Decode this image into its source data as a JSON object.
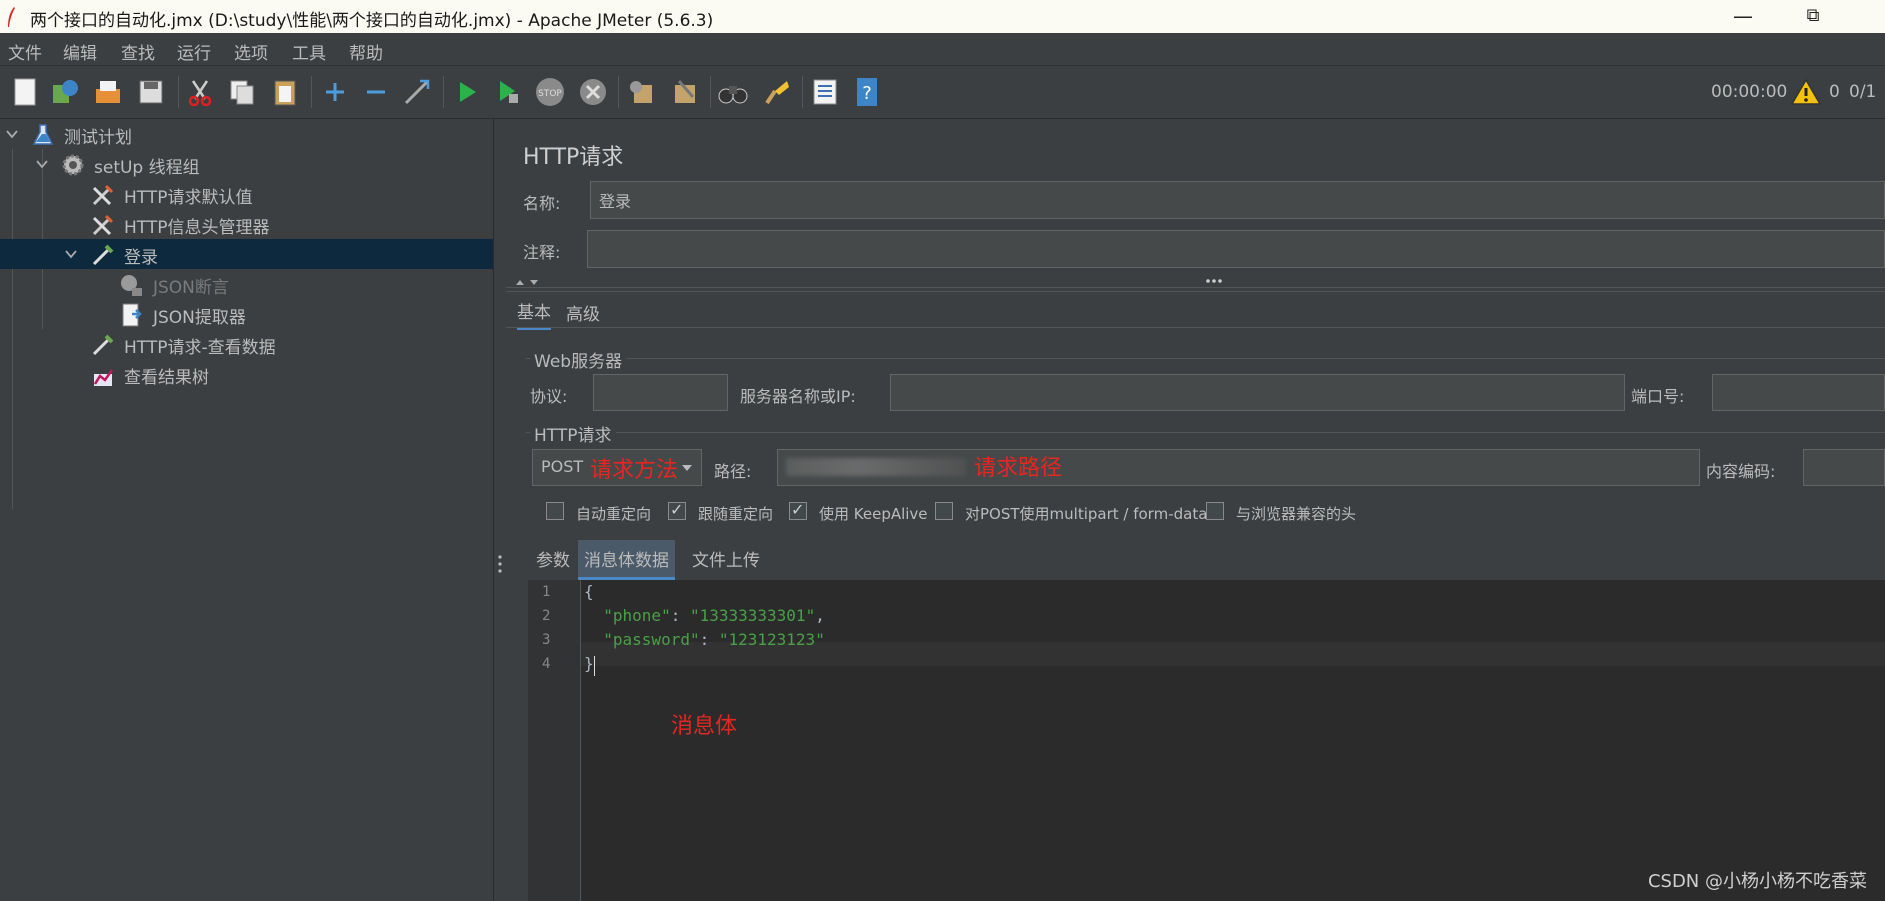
{
  "window": {
    "title": "两个接口的自动化.jmx (D:\\study\\性能\\两个接口的自动化.jmx) - Apache JMeter (5.6.3)",
    "minimize": "—",
    "restore": "⧉"
  },
  "menu": [
    "文件",
    "编辑",
    "查找",
    "运行",
    "选项",
    "工具",
    "帮助"
  ],
  "toolbar_status": {
    "timer": "00:00:00",
    "warnings": "0",
    "threads": "0/1"
  },
  "tree": [
    {
      "label": "测试计划"
    },
    {
      "label": "setUp 线程组"
    },
    {
      "label": "HTTP请求默认值"
    },
    {
      "label": "HTTP信息头管理器"
    },
    {
      "label": "登录"
    },
    {
      "label": "JSON断言"
    },
    {
      "label": "JSON提取器"
    },
    {
      "label": "HTTP请求-查看数据"
    },
    {
      "label": "查看结果树"
    }
  ],
  "panel": {
    "title": "HTTP请求",
    "name_label": "名称:",
    "name_value": "登录",
    "comment_label": "注释:",
    "comment_value": "",
    "tabs": [
      "基本",
      "高级"
    ],
    "web_server": {
      "group": "Web服务器",
      "protocol_label": "协议:",
      "server_label": "服务器名称或IP:",
      "port_label": "端口号:"
    },
    "http_request": {
      "group": "HTTP请求",
      "method": "POST",
      "path_label": "路径:",
      "encoding_label": "内容编码:"
    },
    "options": [
      {
        "label": "自动重定向",
        "checked": false
      },
      {
        "label": "跟随重定向",
        "checked": true
      },
      {
        "label": "使用 KeepAlive",
        "checked": true
      },
      {
        "label": "对POST使用multipart / form-data",
        "checked": false
      },
      {
        "label": "与浏览器兼容的头",
        "checked": false
      }
    ],
    "subtabs": [
      "参数",
      "消息体数据",
      "文件上传"
    ]
  },
  "editor": {
    "line_numbers": [
      "1",
      "2",
      "3",
      "4"
    ],
    "lines": {
      "l1": "{",
      "l2_key": "\"phone\"",
      "l2_sep": ": ",
      "l2_val": "\"13333333301\"",
      "l2_end": ",",
      "l3_key": "\"password\"",
      "l3_sep": ": ",
      "l3_val": "\"123123123\"",
      "l4": "}"
    }
  },
  "annotations": {
    "method": "请求方法",
    "path": "请求路径",
    "body": "消息体"
  },
  "watermark": "CSDN @小杨小杨不吃香菜",
  "colors": {
    "background": "#3c3f41",
    "selection": "#0d293e",
    "annotation": "#e8251f",
    "string": "#48a148"
  }
}
